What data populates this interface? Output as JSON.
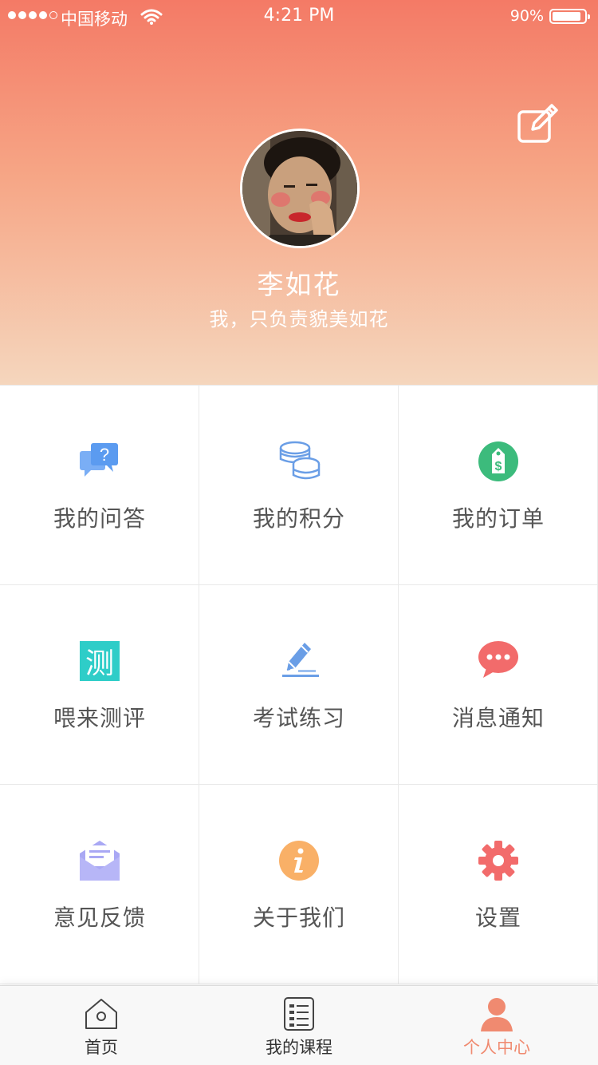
{
  "status_bar": {
    "carrier": "中国移动",
    "time": "4:21 PM",
    "battery": "90%",
    "battery_level": 0.9
  },
  "profile": {
    "name": "李如花",
    "motto": "我，只负责貌美如花"
  },
  "menu": [
    {
      "label": "我的问答",
      "icon": "qa-chat-icon"
    },
    {
      "label": "我的积分",
      "icon": "coins-icon"
    },
    {
      "label": "我的订单",
      "icon": "price-tag-icon"
    },
    {
      "label": "喂来测评",
      "icon": "test-icon",
      "icon_text": "测"
    },
    {
      "label": "考试练习",
      "icon": "pen-icon"
    },
    {
      "label": "消息通知",
      "icon": "message-icon"
    },
    {
      "label": "意见反馈",
      "icon": "mail-icon"
    },
    {
      "label": "关于我们",
      "icon": "info-icon"
    },
    {
      "label": "设置",
      "icon": "gear-icon"
    }
  ],
  "tabbar": [
    {
      "label": "首页",
      "icon": "home-icon",
      "active": false
    },
    {
      "label": "我的课程",
      "icon": "course-list-icon",
      "active": false
    },
    {
      "label": "个人中心",
      "icon": "user-icon",
      "active": true
    }
  ],
  "colors": {
    "accent": "#f08a70",
    "header_top": "#f47a66",
    "header_bottom": "#f5d6bd"
  }
}
